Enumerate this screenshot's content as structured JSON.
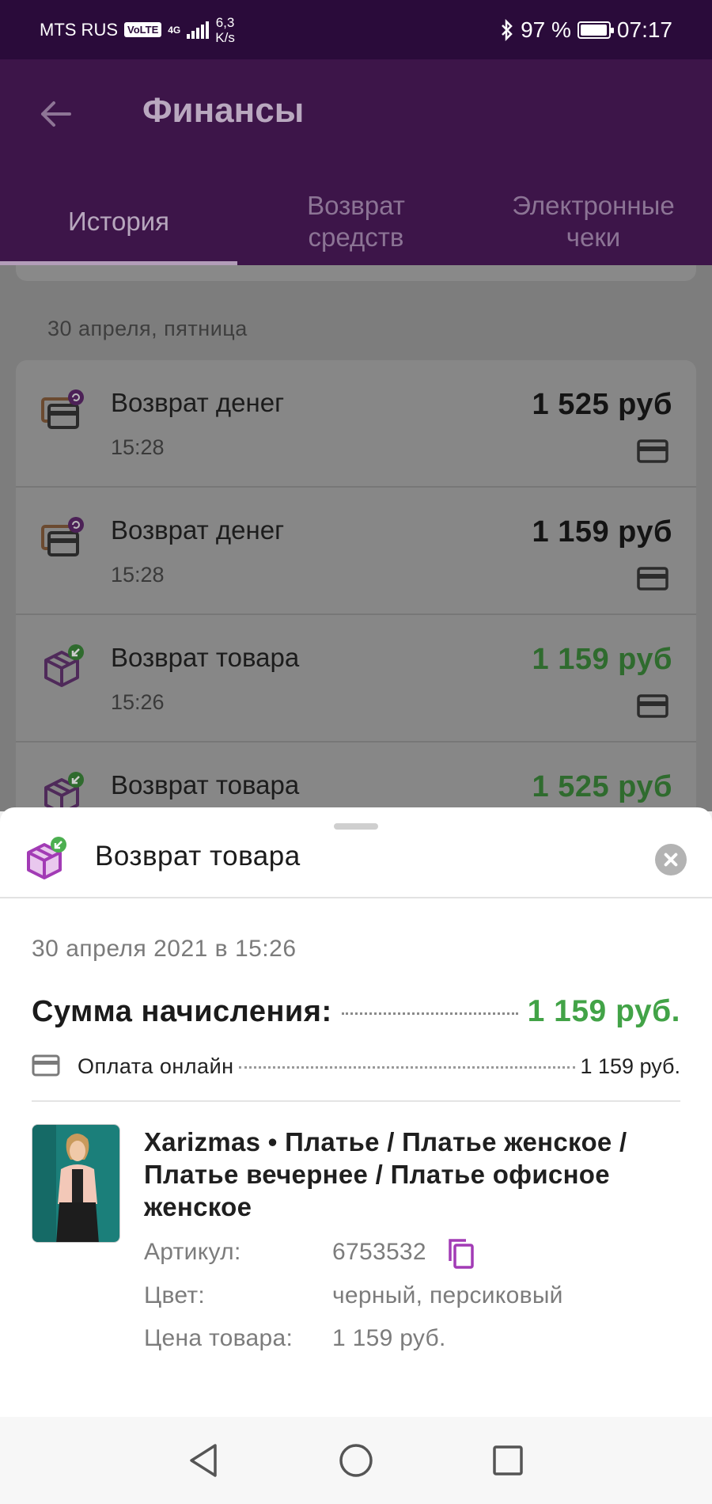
{
  "status_bar": {
    "carrier": "MTS RUS",
    "volte": "VoLTE",
    "network": "4G",
    "speed_value": "6,3",
    "speed_unit": "K/s",
    "battery": "97 %",
    "time": "07:17"
  },
  "app_bar": {
    "title": "Финансы",
    "tabs": [
      {
        "line1": "История",
        "line2": ""
      },
      {
        "line1": "Возврат",
        "line2": "средств"
      },
      {
        "line1": "Электронные",
        "line2": "чеки"
      }
    ],
    "active_tab": 0
  },
  "history": {
    "date_header": "30 апреля, пятница",
    "items": [
      {
        "name": "Возврат денег",
        "time": "15:28",
        "amount": "1 525 руб",
        "kind": "money-return"
      },
      {
        "name": "Возврат денег",
        "time": "15:28",
        "amount": "1 159 руб",
        "kind": "money-return"
      },
      {
        "name": "Возврат товара",
        "time": "15:26",
        "amount": "1 159 руб",
        "kind": "item-return"
      },
      {
        "name": "Возврат товара",
        "time": "",
        "amount": "1 525 руб",
        "kind": "item-return"
      }
    ]
  },
  "sheet": {
    "title": "Возврат товара",
    "datetime": "30 апреля 2021 в 15:26",
    "sum_label": "Сумма начисления:",
    "sum_value": "1 159 руб.",
    "payment_label": "Оплата онлайн",
    "payment_value": "1 159 руб.",
    "product": {
      "name": "Xarizmas • Платье / Платье женское / Платье вечернее / Платье офисное женское",
      "article_label": "Артикул:",
      "article_value": "6753532",
      "color_label": "Цвет:",
      "color_value": "черный, персиковый",
      "price_label": "Цена товара:",
      "price_value": "1 159 руб."
    }
  },
  "colors": {
    "brand_purple": "#3d1549",
    "accent_green": "#42a347",
    "icon_purple": "#a23bb5"
  }
}
